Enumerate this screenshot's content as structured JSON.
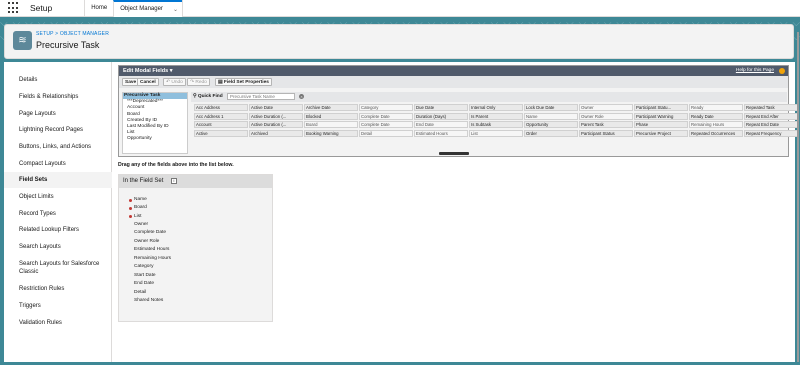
{
  "top": {
    "app_title": "Setup",
    "tabs": [
      {
        "label": "Home"
      },
      {
        "label": "Object Manager"
      }
    ]
  },
  "header": {
    "crumb_setup": "SETUP",
    "crumb_sep": " > ",
    "crumb_object": "OBJECT MANAGER",
    "title": "Precursive Task"
  },
  "sidebar": {
    "items": [
      {
        "label": "Details"
      },
      {
        "label": "Fields & Relationships"
      },
      {
        "label": "Page Layouts"
      },
      {
        "label": "Lightning Record Pages"
      },
      {
        "label": "Buttons, Links, and Actions"
      },
      {
        "label": "Compact Layouts"
      },
      {
        "label": "Field Sets",
        "active": true
      },
      {
        "label": "Object Limits"
      },
      {
        "label": "Record Types"
      },
      {
        "label": "Related Lookup Filters"
      },
      {
        "label": "Search Layouts"
      },
      {
        "label": "Search Layouts for Salesforce Classic"
      },
      {
        "label": "Restriction Rules"
      },
      {
        "label": "Triggers"
      },
      {
        "label": "Validation Rules"
      }
    ]
  },
  "builder": {
    "title": "Edit Modal Fields",
    "help": "Help for this Page",
    "toolbar": {
      "save": "Save",
      "cancel": "Cancel",
      "undo": "Undo",
      "redo": "Redo",
      "properties": "Field Set Properties"
    },
    "object_list": [
      "Precursive Task",
      "***Deprecated***",
      "Account",
      "Board",
      "Created By ID",
      "Last Modified By ID",
      "List",
      "Opportunity"
    ],
    "quick_find_label": "Quick Find",
    "quick_find_placeholder": "Precursive Task Name",
    "field_rows": [
      [
        "Acc Address",
        "Active Date",
        "Archive Date",
        "Category",
        "Due Date",
        "Internal Only",
        "Lock Due Date",
        "Owner",
        "Participant Statu...",
        "Ready",
        "Repeated Task"
      ],
      [
        "Acc Address 1",
        "Active Duration (...",
        "Blocked",
        "Complete Date",
        "Duration (Days)",
        "Is Parent",
        "Name",
        "Owner Role",
        "Participant Warning",
        "Ready Date",
        "Repeat End After"
      ],
      [
        "Account",
        "Active Duration (...",
        "Board",
        "Complete Date",
        "End Date",
        "Is Subtask",
        "Opportunity",
        "Parent Task",
        "Phase",
        "Remaining Hours",
        "Repeat End Date"
      ],
      [
        "Active",
        "Archived",
        "Booking Warning",
        "Detail",
        "Estimated Hours",
        "List",
        "Order",
        "Participant Status",
        "Precursive Project",
        "Repeated Occurrences",
        "Repeat Frequency"
      ]
    ],
    "used_fields": [
      "Owner",
      "Ready",
      "Name",
      "Owner Role",
      "Board",
      "Complete Date",
      "End Date",
      "Remaining Hours",
      "Estimated Hours",
      "List",
      "Detail",
      "Category"
    ]
  },
  "instructions": "Drag any of the fields above into the list below.",
  "field_set": {
    "title": "In the Field Set",
    "required": [
      "Name",
      "Board",
      "List"
    ],
    "items": [
      "Owner",
      "Complete Date",
      "Owner Role",
      "Estimated Hours",
      "Remaining Hours",
      "Category",
      "Start Date",
      "End Date",
      "Detail",
      "Shared Notes"
    ]
  },
  "colors": {
    "accent": "#0176d3",
    "background": "#3e8896",
    "toolbar": "#505a6b",
    "required": "#c23934"
  }
}
